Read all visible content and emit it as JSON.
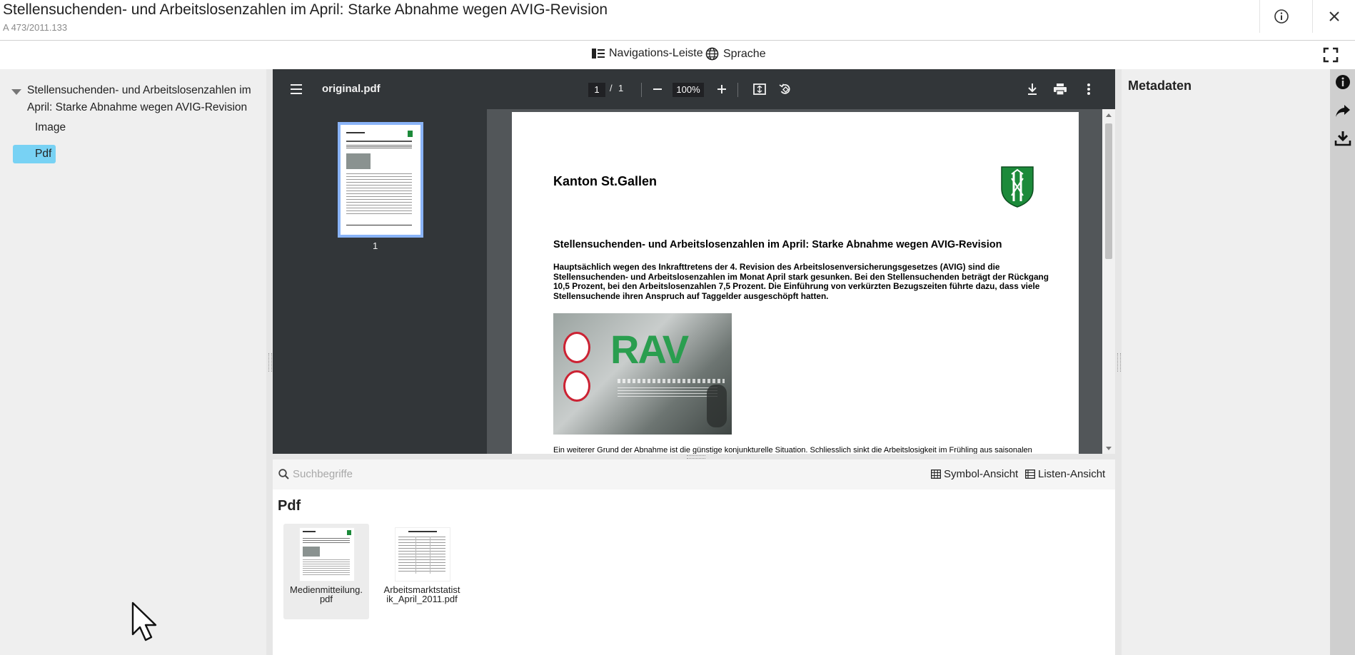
{
  "header": {
    "title": "Stellensuchenden- und Arbeitslosenzahlen im April: Starke Abnahme wegen AVIG-Revision",
    "signature": "A 473/2011.133"
  },
  "navbar": {
    "navigation_label": "Navigations-Leiste",
    "language_label": "Sprache"
  },
  "tree": {
    "root_label": "Stellensuchenden- und Arbeitslosenzahlen im April: Starke Abnahme wegen AVIG-Revision",
    "children": [
      "Image",
      "Pdf"
    ]
  },
  "viewer": {
    "filename": "original.pdf",
    "current_page": "1",
    "page_separator": "/",
    "total_pages": "1",
    "zoom": "100%",
    "thumbnail_number": "1",
    "document": {
      "canton": "Kanton St.Gallen",
      "headline": "Stellensuchenden- und Arbeitslosenzahlen im April: Starke Abnahme wegen AVIG-Revision",
      "lead": "Hauptsächlich wegen des Inkrafttretens der 4. Revision des Arbeitslosenversicherungsgesetzes (AVIG) sind die Stellensuchenden- und Arbeitslosenzahlen im Monat April stark gesunken. Bei den Stellensuchenden beträgt der Rückgang 10,5 Prozent, bei den Arbeitslosenzahlen 7,5 Prozent. Die Einführung von verkürzten Bezugszeiten führte dazu, dass viele Stellensuchende ihren Anspruch auf Taggelder ausgeschöpft hatten.",
      "photo_text": "RAV",
      "footer_partial": "Ein weiterer Grund der Abnahme ist die günstige konjunkturelle Situation. Schliesslich sinkt die Arbeitslosigkeit im Frühling aus saisonalen"
    }
  },
  "search": {
    "placeholder": "Suchbegriffe",
    "symbol_view": "Symbol-Ansicht",
    "list_view": "Listen-Ansicht"
  },
  "results": {
    "title": "Pdf",
    "files": [
      "Medienmitteilung.pdf",
      "Arbeitsmarktstatistik_April_2011.pdf"
    ]
  },
  "metadata": {
    "title": "Metadaten"
  },
  "icons": {
    "info": "info-icon",
    "close": "close-icon",
    "fullscreen": "fullscreen-icon",
    "share": "share-icon",
    "download": "download-icon"
  }
}
